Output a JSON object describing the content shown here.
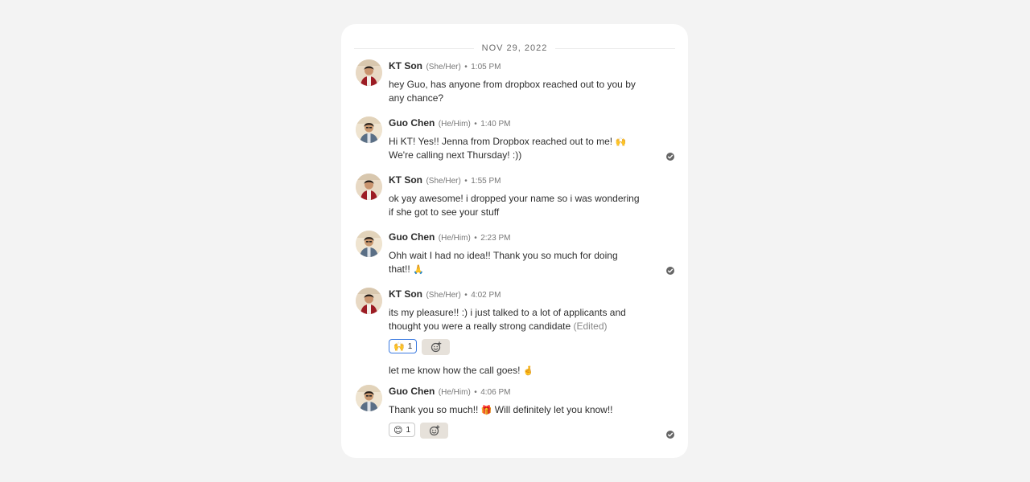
{
  "date_divider": "NOV 29, 2022",
  "messages": [
    {
      "author": "KT Son",
      "pronouns": "(She/Her)",
      "separator": "•",
      "time": "1:05 PM",
      "lines": [
        "hey Guo, has anyone from dropbox reached out to you by",
        "any chance?"
      ]
    },
    {
      "author": "Guo Chen",
      "pronouns": "(He/Him)",
      "separator": "•",
      "time": "1:40 PM",
      "lines": [
        "Hi KT! Yes!! Jenna from Dropbox reached out to me!",
        "We're calling next Thursday! :))"
      ],
      "emoji": "🙌"
    },
    {
      "author": "KT Son",
      "pronouns": "(She/Her)",
      "separator": "•",
      "time": "1:55 PM",
      "lines": [
        "ok yay awesome! i dropped your name so i was wondering",
        "if she got to see your stuff"
      ]
    },
    {
      "author": "Guo Chen",
      "pronouns": "(He/Him)",
      "separator": "•",
      "time": "2:23 PM",
      "lines": [
        "Ohh wait I had no idea!! Thank you so much for doing",
        "that!!"
      ],
      "emoji": "🙏"
    },
    {
      "author": "KT Son",
      "pronouns": "(She/Her)",
      "separator": "•",
      "time": "4:02 PM",
      "lines": [
        "its my pleasure!! :) i just talked to a lot of applicants and",
        "thought you were a really strong candidate"
      ],
      "edited": "(Edited)",
      "reaction": {
        "emoji": "🙌",
        "count": "1"
      },
      "followup": "let me know how the call goes!",
      "followup_emoji": "🤞"
    },
    {
      "author": "Guo Chen",
      "pronouns": "(He/Him)",
      "separator": "•",
      "time": "4:06 PM",
      "lines": [
        "Thank you so much!!",
        "Will definitely let you know!!"
      ],
      "emoji": "🎁",
      "reaction": {
        "emoji": "😊",
        "count": "1"
      }
    }
  ],
  "colors": {
    "background": "#f3f3f3",
    "card": "#ffffff",
    "reaction_active_border": "#3c7be0",
    "add_reaction_bg": "#e6e1da",
    "check": "#666666"
  },
  "icons": {
    "sent_check": "check-circle-icon",
    "add_reaction": "smiley-plus-icon"
  }
}
